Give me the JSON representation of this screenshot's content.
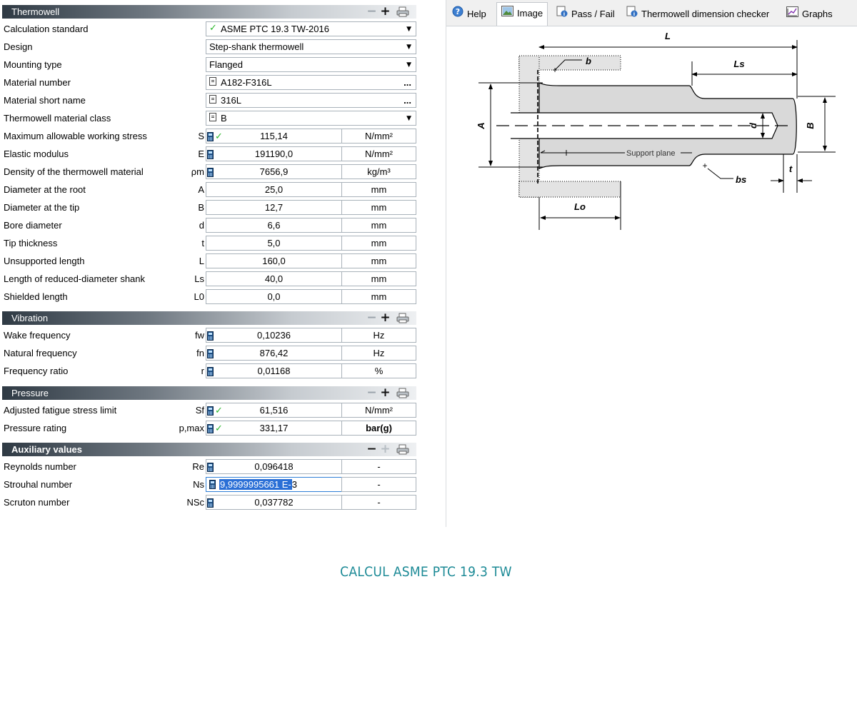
{
  "sections": {
    "thermowell": {
      "title": "Thermowell"
    },
    "vibration": {
      "title": "Vibration"
    },
    "pressure": {
      "title": "Pressure"
    },
    "auxiliary": {
      "title": "Auxiliary values"
    }
  },
  "thermowell_rows": [
    {
      "label": "Calculation standard",
      "value": "ASME PTC 19.3 TW-2016",
      "kind": "select-check"
    },
    {
      "label": "Design",
      "value": "Step-shank thermowell",
      "kind": "select"
    },
    {
      "label": "Mounting type",
      "value": "Flanged",
      "kind": "select"
    },
    {
      "label": "Material number",
      "value": "A182-F316L",
      "kind": "browse-doc"
    },
    {
      "label": "Material short name",
      "value": "316L",
      "kind": "browse-doc"
    },
    {
      "label": "Thermowell material class",
      "value": "B",
      "kind": "select-doc"
    },
    {
      "label": "Maximum allowable working stress",
      "symbol": "S",
      "value": "115,14",
      "unit": "N/mm²",
      "icons": [
        "calculator",
        "check"
      ]
    },
    {
      "label": "Elastic modulus",
      "symbol": "E",
      "value": "191190,0",
      "unit": "N/mm²",
      "icons": [
        "calculator"
      ]
    },
    {
      "label": "Density of the thermowell material",
      "symbol": "ρm",
      "value": "7656,9",
      "unit": "kg/m³",
      "icons": [
        "calculator"
      ]
    },
    {
      "label": "Diameter at the root",
      "symbol": "A",
      "value": "25,0",
      "unit": "mm"
    },
    {
      "label": "Diameter at the tip",
      "symbol": "B",
      "value": "12,7",
      "unit": "mm"
    },
    {
      "label": "Bore diameter",
      "symbol": "d",
      "value": "6,6",
      "unit": "mm"
    },
    {
      "label": "Tip thickness",
      "symbol": "t",
      "value": "5,0",
      "unit": "mm"
    },
    {
      "label": "Unsupported length",
      "symbol": "L",
      "value": "160,0",
      "unit": "mm"
    },
    {
      "label": "Length of reduced-diameter shank",
      "symbol": "Ls",
      "value": "40,0",
      "unit": "mm"
    },
    {
      "label": "Shielded length",
      "symbol": "L0",
      "value": "0,0",
      "unit": "mm"
    }
  ],
  "vibration_rows": [
    {
      "label": "Wake frequency",
      "symbol": "fw",
      "value": "0,10236",
      "unit": "Hz",
      "icons": [
        "calculator"
      ]
    },
    {
      "label": "Natural frequency",
      "symbol": "fn",
      "value": "876,42",
      "unit": "Hz",
      "icons": [
        "calculator"
      ]
    },
    {
      "label": "Frequency ratio",
      "symbol": "r",
      "value": "0,01168",
      "unit": "%",
      "icons": [
        "calculator"
      ]
    }
  ],
  "pressure_rows": [
    {
      "label": "Adjusted fatigue stress limit",
      "symbol": "Sf",
      "value": "61,516",
      "unit": "N/mm²",
      "icons": [
        "calculator",
        "check"
      ]
    },
    {
      "label": "Pressure rating",
      "symbol": "p,max",
      "value": "331,17",
      "unit": "bar(g)",
      "unit_bold": true,
      "icons": [
        "calculator",
        "check"
      ]
    }
  ],
  "auxiliary_rows": [
    {
      "label": "Reynolds number",
      "symbol": "Re",
      "value": "0,096418",
      "unit": "-",
      "icons": [
        "calculator"
      ]
    },
    {
      "label": "Strouhal number",
      "symbol": "Ns",
      "value_selected": "9,9999995661 E-",
      "value_rest": "3",
      "unit": "-",
      "selected": true
    },
    {
      "label": "Scruton number",
      "symbol": "NSc",
      "value": "0,037782",
      "unit": "-",
      "icons": [
        "calculator"
      ]
    }
  ],
  "tabs": [
    {
      "label": "Help",
      "icon": "help-icon"
    },
    {
      "label": "Image",
      "icon": "image-icon",
      "active": true
    },
    {
      "label": "Pass / Fail",
      "icon": "info-report-icon"
    },
    {
      "label": "Thermowell dimension checker",
      "icon": "info-report-icon"
    },
    {
      "label": "Graphs",
      "icon": "graph-icon"
    }
  ],
  "drawing": {
    "labels": {
      "L": "L",
      "Ls": "Ls",
      "b": "b",
      "A": "A",
      "d": "d",
      "B": "B",
      "support": "Support plane",
      "bs": "bs",
      "t": "t",
      "Lo": "Lo"
    }
  },
  "caption": "CALCUL ASME PTC 19.3 TW",
  "colors": {
    "caption": "#1c8a96",
    "check": "#2db82d",
    "selection": "#2a6fd6",
    "header_dark": "#2f3a44"
  }
}
